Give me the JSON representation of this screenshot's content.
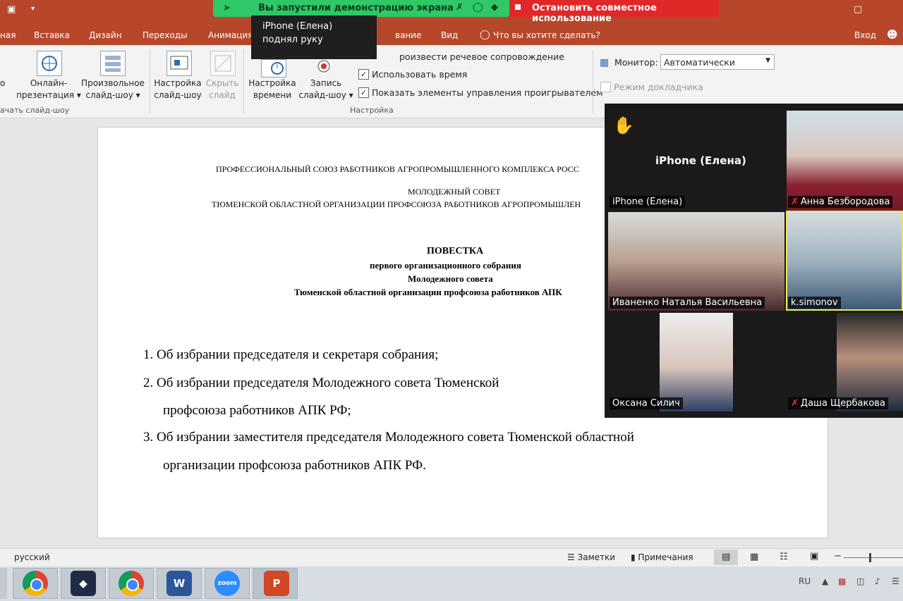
{
  "app": {
    "tabs": [
      "ная",
      "Вставка",
      "Дизайн",
      "Переходы",
      "Анимация",
      "вание",
      "Вид"
    ],
    "search_prompt": "Что вы хотите сделать?",
    "signin": "Вход"
  },
  "zoom": {
    "share_status": "Вы запустили демонстрацию экрана",
    "stop_share": "Остановить совместное использование",
    "tooltip": "iPhone (Елена) поднял руку",
    "participants": [
      {
        "name": "iPhone (Елена)",
        "muted": false,
        "hand_raised": true
      },
      {
        "name": "Анна Безбородова",
        "muted": true
      },
      {
        "name": "Иваненко Наталья Васильевна",
        "muted": false
      },
      {
        "name": "k.simonov",
        "muted": false
      },
      {
        "name": "Оксана Силич",
        "muted": false
      },
      {
        "name": "Даша Щербакова",
        "muted": true
      }
    ],
    "center_name": "iPhone (Елена)"
  },
  "ribbon": {
    "btn_online_1": "Онлайн-",
    "btn_online_2": "презентация ▾",
    "btn_custom_1": "Произвольное",
    "btn_custom_2": "слайд-шоу ▾",
    "group_start": "ачать слайд-шоу",
    "btn_setup_1": "Настройка",
    "btn_setup_2": "слайд-шоу",
    "btn_hide_1": "Скрыть",
    "btn_hide_2": "слайд",
    "btn_timing_1": "Настройка",
    "btn_timing_2": "времени",
    "btn_record_1": "Запись",
    "btn_record_2": "слайд-шоу ▾",
    "chk_narration": "роизвести речевое сопровождение",
    "chk_timing": "Использовать время",
    "chk_controls": "Показать элементы управления проигрывателем",
    "group_setup": "Настройка",
    "monitor_label": "Монитор:",
    "monitor_value": "Автоматически",
    "presenter_view": "Режим докладчика",
    "left_cut": "о"
  },
  "slide": {
    "header1": "ПРОФЕССИОНАЛЬНЫЙ СОЮЗ РАБОТНИКОВ АГРОПРОМЫШЛЕННОГО КОМПЛЕКСА РОСС",
    "header2": "МОЛОДЕЖНЫЙ СОВЕТ",
    "header3": "ТЮМЕНСКОЙ ОБЛАСТНОЙ ОРГАНИЗАЦИИ ПРОФСОЮЗА РАБОТНИКОВ АГРОПРОМЫШЛЕН",
    "title1": "ПОВЕСТКА",
    "title2": "первого организационного собрания",
    "title3": "Молодежного совета",
    "title4": "Тюменской областной организации профсоюза работников АПК",
    "item1": "1.  Об избрании председателя и секретаря собрания;",
    "item2a": "2.  Об   избрании   председателя   Молодежного   совета   Тюменской",
    "item2b": "профсоюза работников АПК РФ;",
    "item3a": "3.  Об   избрании   заместителя   председателя   Молодежного   совета   Тюменской   областной",
    "item3b": "организации профсоюза работников АПК РФ."
  },
  "status": {
    "language": "русский",
    "notes": "Заметки",
    "comments": "Примечания"
  },
  "taskbar": {
    "lang": "RU",
    "zoom_label": "zoom"
  },
  "colors": {
    "ppt_red": "#b7472a",
    "zoom_green": "#2ec866",
    "zoom_red": "#e02828"
  }
}
